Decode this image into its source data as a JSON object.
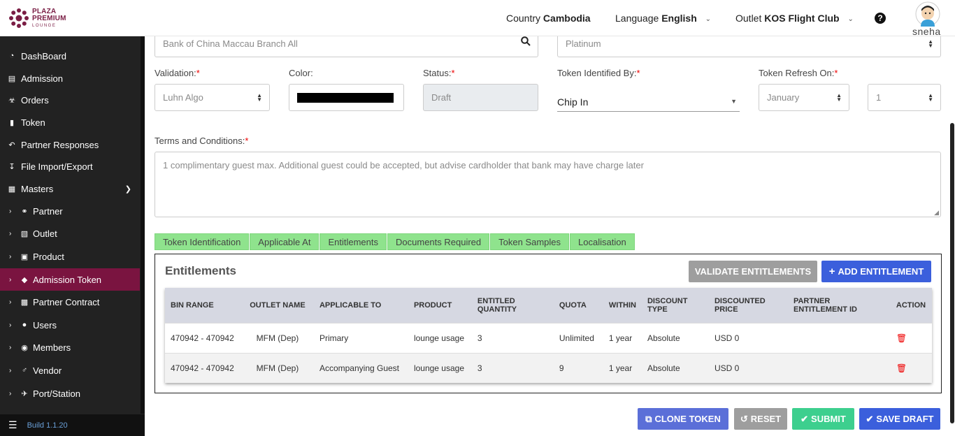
{
  "header": {
    "logo_line1": "PLAZA",
    "logo_line2": "PREMIUM",
    "logo_line3": "LOUNGE",
    "country_label": "Country",
    "country_value": "Cambodia",
    "language_label": "Language",
    "language_value": "English",
    "outlet_label": "Outlet",
    "outlet_value": "KOS Flight Club",
    "help_icon": "?",
    "username": "sneha"
  },
  "sidebar": {
    "items": [
      {
        "label": "DashBoard",
        "icon": "dashboard-icon"
      },
      {
        "label": "Admission",
        "icon": "id-card-icon"
      },
      {
        "label": "Orders",
        "icon": "cart-icon"
      },
      {
        "label": "Token",
        "icon": "file-icon"
      },
      {
        "label": "Partner Responses",
        "icon": "reply-icon"
      },
      {
        "label": "File Import/Export",
        "icon": "download-icon"
      },
      {
        "label": "Masters",
        "icon": "sitemap-icon"
      }
    ],
    "children": [
      {
        "label": "Partner",
        "icon": "handshake-icon"
      },
      {
        "label": "Outlet",
        "icon": "building-icon"
      },
      {
        "label": "Product",
        "icon": "gift-icon"
      },
      {
        "label": "Admission Token",
        "icon": "tag-icon"
      },
      {
        "label": "Partner Contract",
        "icon": "briefcase-icon"
      },
      {
        "label": "Users",
        "icon": "user-icon"
      },
      {
        "label": "Members",
        "icon": "users-icon"
      },
      {
        "label": "Vendor",
        "icon": "male-icon"
      },
      {
        "label": "Port/Station",
        "icon": "plane-icon"
      }
    ],
    "build_label": "Build 1.1.20",
    "colors": {
      "active": "#7a1440",
      "background": "#222222"
    }
  },
  "form": {
    "bank_value": "Bank of China Maccau Branch All",
    "tier_value": "Platinum",
    "validation_label": "Validation:",
    "validation_value": "Luhn Algo",
    "color_label": "Color:",
    "status_label": "Status:",
    "status_value": "Draft",
    "token_identified_label": "Token Identified By:",
    "token_identified_value": "Chip In",
    "token_refresh_label": "Token Refresh On:",
    "token_refresh_month": "January",
    "token_refresh_day": "1",
    "terms_label": "Terms and Conditions:",
    "terms_value": "1 complimentary guest max. Additional guest could be accepted, but advise cardholder that bank may have charge later",
    "required_mark": "*"
  },
  "tabs": [
    "Token Identification",
    "Applicable At",
    "Entitlements",
    "Documents Required",
    "Token Samples",
    "Localisation"
  ],
  "entitlements": {
    "title": "Entitlements",
    "validate_label": "VALIDATE ENTITLEMENTS",
    "add_label": "ADD ENTITLEMENT",
    "columns": [
      "BIN RANGE",
      "OUTLET NAME",
      "APPLICABLE TO",
      "PRODUCT",
      "ENTITLED QUANTITY",
      "QUOTA",
      "WITHIN",
      "DISCOUNT TYPE",
      "DISCOUNTED PRICE",
      "PARTNER ENTITLEMENT ID",
      "ACTION"
    ],
    "rows": [
      [
        "470942 - 470942",
        "MFM (Dep)",
        "Primary",
        "lounge usage",
        "3",
        "Unlimited",
        "1 year",
        "Absolute",
        "USD 0",
        ""
      ],
      [
        "470942 - 470942",
        "MFM (Dep)",
        "Accompanying Guest",
        "lounge usage",
        "3",
        "9",
        "1 year",
        "Absolute",
        "USD 0",
        ""
      ]
    ]
  },
  "actions": {
    "clone_label": "CLONE TOKEN",
    "reset_label": "RESET",
    "submit_label": "SUBMIT",
    "save_label": "SAVE DRAFT"
  }
}
